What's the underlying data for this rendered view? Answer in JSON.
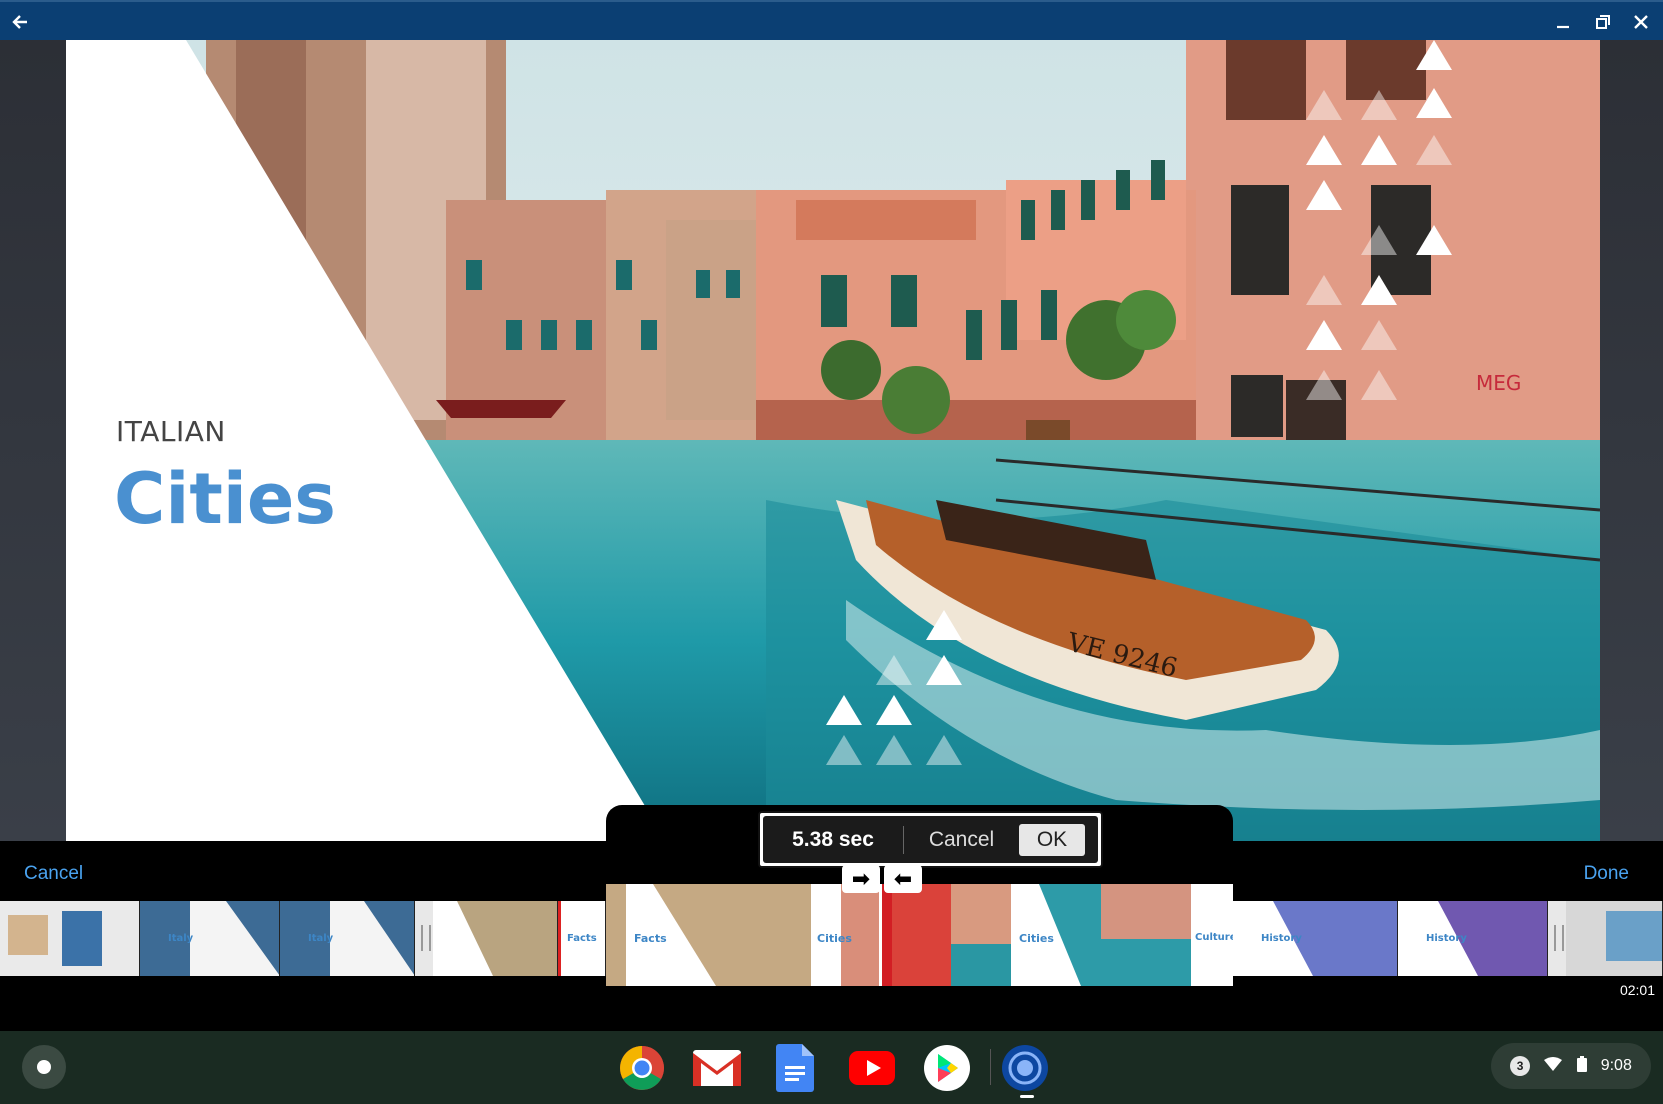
{
  "window": {
    "back_icon": "back-arrow-icon",
    "controls": [
      "minimize-icon",
      "maximize-icon",
      "close-icon"
    ]
  },
  "slide": {
    "heading_small": "ITALIAN",
    "heading_big": "Cities",
    "wall_text": "MEG",
    "boat_text": "VE 9246",
    "accent_color": "#4a90d0"
  },
  "editbar": {
    "cancel_label": "Cancel",
    "done_label": "Done",
    "end_time": "02:01",
    "link_color": "#4aa3f0"
  },
  "timeline": {
    "thumbs": [
      "Italy",
      "Italy",
      "Facts",
      "Cities",
      "Culture",
      "History",
      "History"
    ]
  },
  "trim": {
    "duration": "5.38 sec",
    "cancel_label": "Cancel",
    "ok_label": "OK",
    "right_arrow": "➡",
    "left_arrow": "⬅",
    "thumbs": [
      "Facts",
      "Cities",
      "Cities",
      "Culture"
    ]
  },
  "shelf": {
    "apps": [
      "Chrome",
      "Gmail",
      "Docs",
      "YouTube",
      "Play Store",
      "Screen recorder"
    ],
    "tray_badge": "3",
    "time": "9:08"
  }
}
